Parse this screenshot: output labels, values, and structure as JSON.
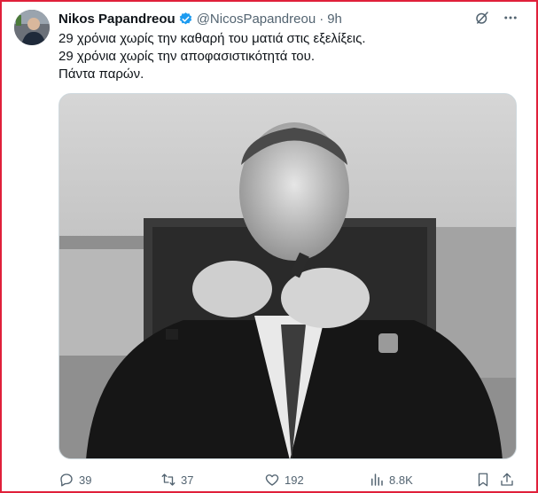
{
  "post": {
    "author_name": "Nikos Papandreou",
    "handle": "@NicosPapandreou",
    "separator": "·",
    "time": "9h",
    "text_lines": [
      "29 χρόνια χωρίς την καθαρή του ματιά στις εξελίξεις.",
      "29 χρόνια χωρίς την αποφασιστικότητά του.",
      "Πάντα παρών."
    ]
  },
  "media": {
    "description_icon": "photo"
  },
  "actions": {
    "replies": "39",
    "reposts": "37",
    "likes": "192",
    "views": "8.8K"
  },
  "colors": {
    "text": "#0f1419",
    "muted": "#536471",
    "verified": "#1d9bf0",
    "frame_border": "#e0203a"
  },
  "icons": {
    "verified": "verified-badge-icon",
    "grok": "grok-icon",
    "more": "more-icon",
    "reply": "reply-icon",
    "repost": "repost-icon",
    "like": "heart-icon",
    "views": "views-icon",
    "bookmark": "bookmark-icon",
    "share": "share-icon"
  }
}
